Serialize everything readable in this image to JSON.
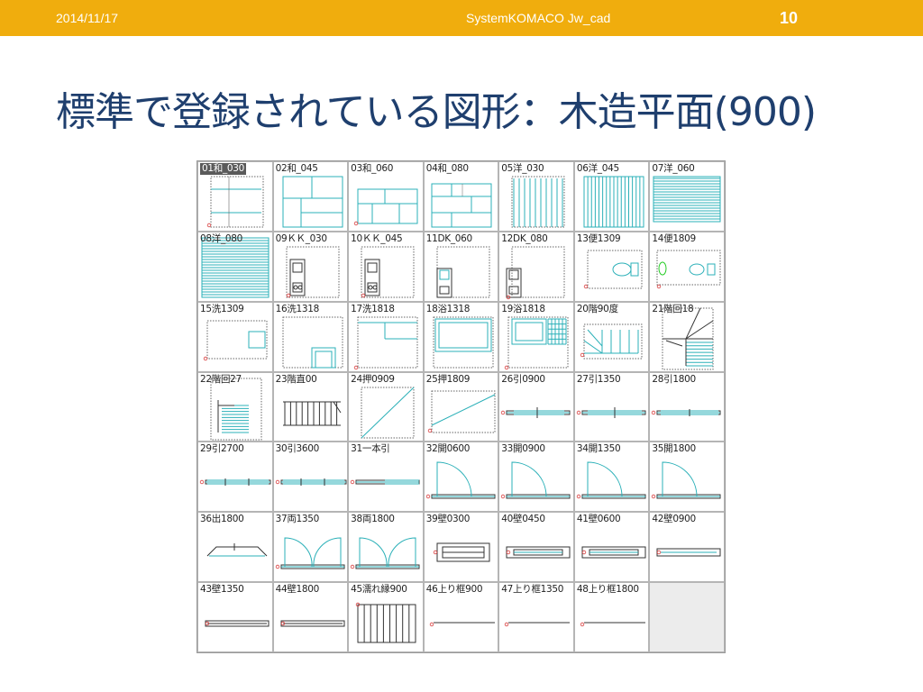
{
  "header": {
    "date": "2014/11/17",
    "center_text": "SystemKOMACO Jw_cad",
    "page_number": "10"
  },
  "slide": {
    "title": "標準で登録されている図形：木造平面(900)"
  },
  "symbols": [
    {
      "label": "01和_030",
      "kind": "wa030",
      "selected": true
    },
    {
      "label": "02和_045",
      "kind": "wa045"
    },
    {
      "label": "03和_060",
      "kind": "wa060"
    },
    {
      "label": "04和_080",
      "kind": "wa080"
    },
    {
      "label": "05洋_030",
      "kind": "yo030"
    },
    {
      "label": "06洋_045",
      "kind": "yo045"
    },
    {
      "label": "07洋_060",
      "kind": "yo060"
    },
    {
      "label": "08洋_080",
      "kind": "yo080"
    },
    {
      "label": "09ＫＫ_030",
      "kind": "k030"
    },
    {
      "label": "10ＫＫ_045",
      "kind": "k045"
    },
    {
      "label": "11DK_060",
      "kind": "dk060"
    },
    {
      "label": "12DK_080",
      "kind": "dk080"
    },
    {
      "label": "13便1309",
      "kind": "toilet1309"
    },
    {
      "label": "14便1809",
      "kind": "toilet1809"
    },
    {
      "label": "15洗1309",
      "kind": "wash1309"
    },
    {
      "label": "16洗1318",
      "kind": "wash1318"
    },
    {
      "label": "17洗1818",
      "kind": "wash1818"
    },
    {
      "label": "18浴1318",
      "kind": "bath1318"
    },
    {
      "label": "19浴1818",
      "kind": "bath1818"
    },
    {
      "label": "20階90度",
      "kind": "stair90"
    },
    {
      "label": "21階回18",
      "kind": "stairturn18"
    },
    {
      "label": "22階回27",
      "kind": "stairturn27"
    },
    {
      "label": "23階直00",
      "kind": "stairstraight"
    },
    {
      "label": "24押0909",
      "kind": "closet0909"
    },
    {
      "label": "25押1809",
      "kind": "closet1809"
    },
    {
      "label": "26引0900",
      "kind": "slide0900"
    },
    {
      "label": "27引1350",
      "kind": "slide1350"
    },
    {
      "label": "28引1800",
      "kind": "slide1800"
    },
    {
      "label": "29引2700",
      "kind": "slide2700"
    },
    {
      "label": "30引3600",
      "kind": "slide3600"
    },
    {
      "label": "31一本引",
      "kind": "single"
    },
    {
      "label": "32開0600",
      "kind": "open0600"
    },
    {
      "label": "33開0900",
      "kind": "open0900"
    },
    {
      "label": "34開1350",
      "kind": "open1350"
    },
    {
      "label": "35開1800",
      "kind": "open1800"
    },
    {
      "label": "36出1800",
      "kind": "bay1800"
    },
    {
      "label": "37両1350",
      "kind": "double1350"
    },
    {
      "label": "38両1800",
      "kind": "double1800"
    },
    {
      "label": "39壁0300",
      "kind": "wall0300"
    },
    {
      "label": "40壁0450",
      "kind": "wall0450"
    },
    {
      "label": "41壁0600",
      "kind": "wall0600"
    },
    {
      "label": "42壁0900",
      "kind": "wall0900"
    },
    {
      "label": "43壁1350",
      "kind": "wall1350"
    },
    {
      "label": "44壁1800",
      "kind": "wall1800"
    },
    {
      "label": "45濡れ縁900",
      "kind": "deck900"
    },
    {
      "label": "46上り框900",
      "kind": "step900"
    },
    {
      "label": "47上り框1350",
      "kind": "step1350"
    },
    {
      "label": "48上り框1800",
      "kind": "step1800"
    },
    {
      "label": "",
      "kind": "empty"
    }
  ],
  "colors": {
    "header_bg": "#f0ad0d",
    "title": "#1f3f6e",
    "drawing_line": "#2bb0b8",
    "origin_marker": "#d94040"
  }
}
